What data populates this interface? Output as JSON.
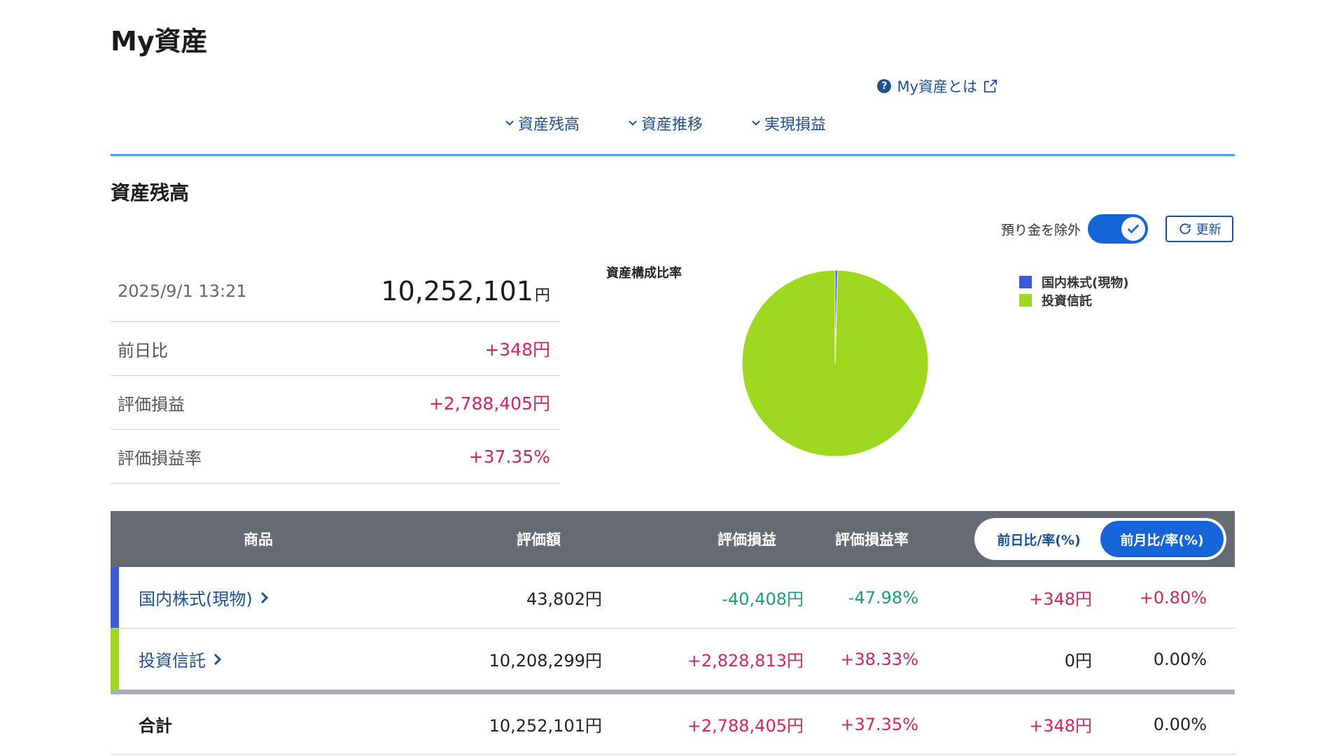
{
  "page": {
    "title": "My資産"
  },
  "help": {
    "label": "My資産とは"
  },
  "anchors": [
    "資産残高",
    "資産推移",
    "実現損益"
  ],
  "section": {
    "title": "資産残高"
  },
  "controls": {
    "toggle_label": "預り金を除外",
    "refresh_label": "更新",
    "toggle_on": true
  },
  "summary": {
    "datetime": "2025/9/1 13:21",
    "total": "10,252,101",
    "unit": "円",
    "rows": [
      {
        "label": "前日比",
        "value": "+348円"
      },
      {
        "label": "評価損益",
        "value": "+2,788,405円"
      },
      {
        "label": "評価損益率",
        "value": "+37.35%"
      }
    ]
  },
  "composition": {
    "title": "資産構成比率",
    "legend": [
      {
        "label": "国内株式(現物)",
        "color": "#3b5bdb"
      },
      {
        "label": "投資信託",
        "color": "#9ed81f"
      }
    ],
    "values": [
      43802,
      10208299
    ]
  },
  "table": {
    "headers": {
      "product": "商品",
      "valuation": "評価額",
      "pl": "評価損益",
      "pl_rate": "評価損益率"
    },
    "toggle": {
      "daily": "前日比/率(%)",
      "monthly": "前月比/率(%)",
      "active": "monthly"
    },
    "rows": [
      {
        "name": "国内株式(現物)",
        "color": "#3b5bdb",
        "valuation": "43,802円",
        "pl": "-40,408円",
        "pl_rate": "-47.98%",
        "change": "+348円",
        "change_rate": "+0.80%",
        "pl_class": "neg",
        "rate_class": "neg",
        "change_class": "pos",
        "change_rate_class": "pos"
      },
      {
        "name": "投資信託",
        "color": "#9ed81f",
        "valuation": "10,208,299円",
        "pl": "+2,828,813円",
        "pl_rate": "+38.33%",
        "change": "0円",
        "change_rate": "0.00%",
        "pl_class": "pos",
        "rate_class": "pos",
        "change_class": "neu",
        "change_rate_class": "neu"
      }
    ],
    "total": {
      "label": "合計",
      "valuation": "10,252,101円",
      "pl": "+2,788,405円",
      "pl_rate": "+37.35%",
      "change": "+348円",
      "change_rate": "0.00%"
    }
  }
}
